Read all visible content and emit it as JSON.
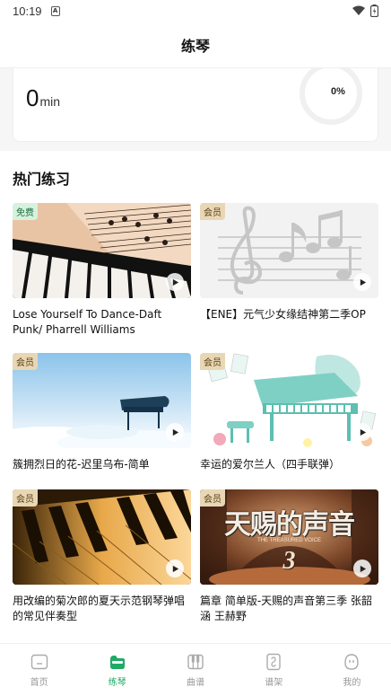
{
  "status": {
    "time": "10:19",
    "sim_glyph": "A"
  },
  "header": {
    "title": "练琴"
  },
  "stats": {
    "minutes_value": "0",
    "minutes_unit": "min",
    "progress_label": "0%",
    "progress_fraction": 0
  },
  "hot": {
    "title": "热门练习",
    "items": [
      {
        "badge": "免费",
        "badge_type": "free",
        "caption": "Lose Yourself To Dance-Daft Punk/ Pharrell Williams"
      },
      {
        "badge": "会员",
        "badge_type": "vip",
        "caption": "【ENE】元气少女缘结神第二季OP"
      },
      {
        "badge": "会员",
        "badge_type": "vip",
        "caption": "簇拥烈日的花-迟里乌布-简单"
      },
      {
        "badge": "会员",
        "badge_type": "vip",
        "caption": "幸运的爱尔兰人（四手联弹）"
      },
      {
        "badge": "会员",
        "badge_type": "vip",
        "caption": "用改编的菊次郎的夏天示范钢琴弹唱的常见伴奏型"
      },
      {
        "badge": "会员",
        "badge_type": "vip",
        "caption": "篇章 简单版-天赐的声音第三季 张韶涵 王赫野"
      }
    ],
    "thumb5_text_main": "天赐的声音",
    "thumb5_text_sub": "THE TREASURED VOICE",
    "thumb5_text_num": "3"
  },
  "tabs": [
    {
      "label": "首页",
      "icon": "home-icon",
      "active": false
    },
    {
      "label": "练琴",
      "icon": "practice-icon",
      "active": true
    },
    {
      "label": "曲谱",
      "icon": "piano-keys-icon",
      "active": false
    },
    {
      "label": "谱架",
      "icon": "music-stand-icon",
      "active": false
    },
    {
      "label": "我的",
      "icon": "profile-icon",
      "active": false
    }
  ],
  "colors": {
    "accent": "#1faa66",
    "vip_badge": "#e8d7b5",
    "free_badge": "#d6f2df"
  }
}
